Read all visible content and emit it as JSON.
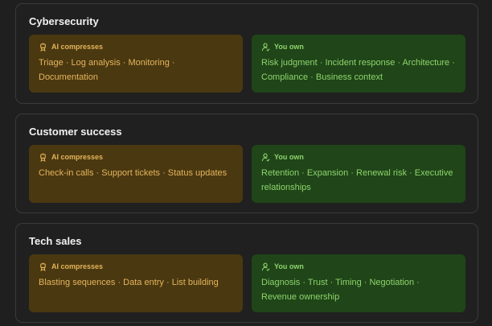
{
  "sections": [
    {
      "title": "Cybersecurity",
      "ai": {
        "label": "AI compresses",
        "text": "Triage · Log analysis · Monitoring · Documentation"
      },
      "own": {
        "label": "You own",
        "text": "Risk judgment · Incident response · Architecture · Compliance · Business context"
      }
    },
    {
      "title": "Customer success",
      "ai": {
        "label": "AI compresses",
        "text": "Check-in calls · Support tickets · Status updates"
      },
      "own": {
        "label": "You own",
        "text": "Retention · Expansion · Renewal risk · Executive relationships"
      }
    },
    {
      "title": "Tech sales",
      "ai": {
        "label": "AI compresses",
        "text": "Blasting sequences · Data entry · List building"
      },
      "own": {
        "label": "You own",
        "text": "Diagnosis · Trust · Timing · Negotiation · Revenue ownership"
      }
    }
  ],
  "icons": {
    "ai": "robot-icon",
    "own": "user-icon"
  },
  "colors": {
    "background": "#1f1f1f",
    "card_border": "#3a3a3a",
    "ai_bg": "#4a3810",
    "ai_text": "#e5b55d",
    "own_bg": "#1f4518",
    "own_text": "#8fd46e"
  }
}
